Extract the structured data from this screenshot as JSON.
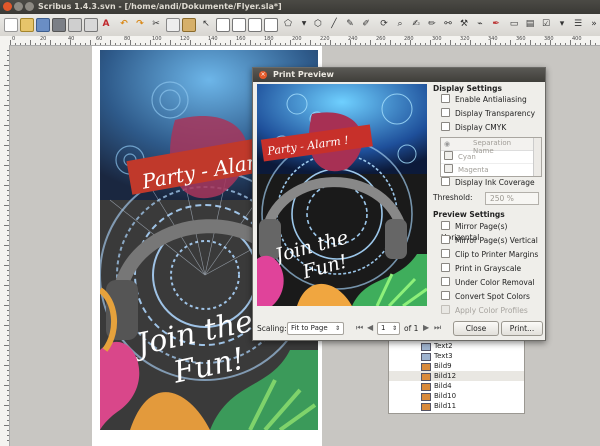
{
  "window": {
    "title": "Scribus 1.4.3.svn - [/home/andi/Dokumente/Flyer.sla*]"
  },
  "rulers": {
    "top_labels": [
      "0",
      "20",
      "40",
      "60",
      "80",
      "100",
      "120",
      "140",
      "160",
      "180",
      "200",
      "220",
      "240",
      "260",
      "280",
      "300",
      "320",
      "340",
      "360",
      "380",
      "400"
    ]
  },
  "flyer": {
    "headline": "Party - Alarm",
    "slogan_line1": "Join the",
    "slogan_line2": "Fun!"
  },
  "preview_flyer": {
    "headline": "Party - Alarm !",
    "slogan_line1": "Join the",
    "slogan_line2": "Fun!"
  },
  "dialog": {
    "title": "Print Preview",
    "display_settings": {
      "heading": "Display Settings",
      "enable_antialiasing": "Enable Antialiasing",
      "display_transparency": "Display Transparency",
      "display_cmyk": "Display CMYK",
      "separation_header": "Separation Name",
      "separations": [
        "Cyan",
        "Magenta"
      ],
      "display_ink_coverage": "Display Ink Coverage",
      "threshold_label": "Threshold:",
      "threshold_value": "250 %"
    },
    "preview_settings": {
      "heading": "Preview Settings",
      "mirror_horizontal": "Mirror Page(s) Horizontal",
      "mirror_vertical": "Mirror Page(s) Vertical",
      "clip_margins": "Clip to Printer Margins",
      "grayscale": "Print in Grayscale",
      "under_color_removal": "Under Color Removal",
      "convert_spot": "Convert Spot Colors",
      "apply_profiles": "Apply Color Profiles"
    },
    "scaling_label": "Scaling:",
    "scaling_value": "Fit to Page",
    "page_value": "1",
    "page_total": "of 1",
    "close_button": "Close",
    "print_button": "Print..."
  },
  "layers_panel": {
    "items": [
      "Text2",
      "Text3",
      "Bild9",
      "Bild12",
      "Bild4",
      "Bild10",
      "Bild11"
    ],
    "selected": "Bild12"
  },
  "colors": {
    "accent": "#e45a2a",
    "banner": "#c0392b"
  }
}
